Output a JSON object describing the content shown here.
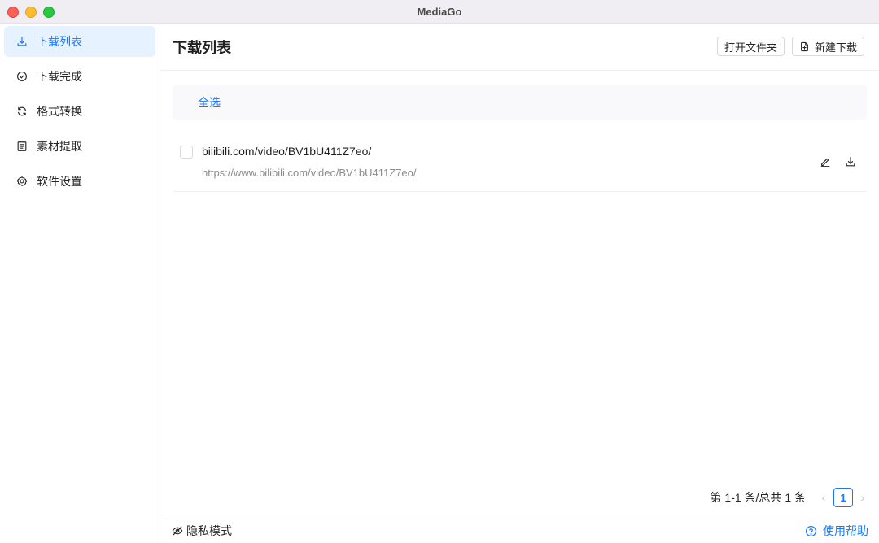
{
  "window": {
    "title": "MediaGo"
  },
  "sidebar": {
    "items": [
      {
        "label": "下载列表",
        "icon": "download-icon",
        "active": true
      },
      {
        "label": "下载完成",
        "icon": "check-circle-icon",
        "active": false
      },
      {
        "label": "格式转换",
        "icon": "sync-icon",
        "active": false
      },
      {
        "label": "素材提取",
        "icon": "file-text-icon",
        "active": false
      },
      {
        "label": "软件设置",
        "icon": "gear-icon",
        "active": false
      }
    ]
  },
  "header": {
    "title": "下载列表",
    "open_folder_label": "打开文件夹",
    "new_download_label": "新建下载"
  },
  "list": {
    "select_all_label": "全选",
    "items": [
      {
        "title": "bilibili.com/video/BV1bU411Z7eo/",
        "url": "https://www.bilibili.com/video/BV1bU411Z7eo/"
      }
    ]
  },
  "pagination": {
    "total_text": "第 1-1 条/总共 1 条",
    "current_page": "1",
    "prev_symbol": "‹",
    "next_symbol": "›"
  },
  "footer": {
    "privacy_label": "隐私模式",
    "help_label": "使用帮助"
  },
  "colors": {
    "accent": "#1677ff",
    "active_bg": "#e6f2ff",
    "muted_text": "#8c8c8c"
  }
}
